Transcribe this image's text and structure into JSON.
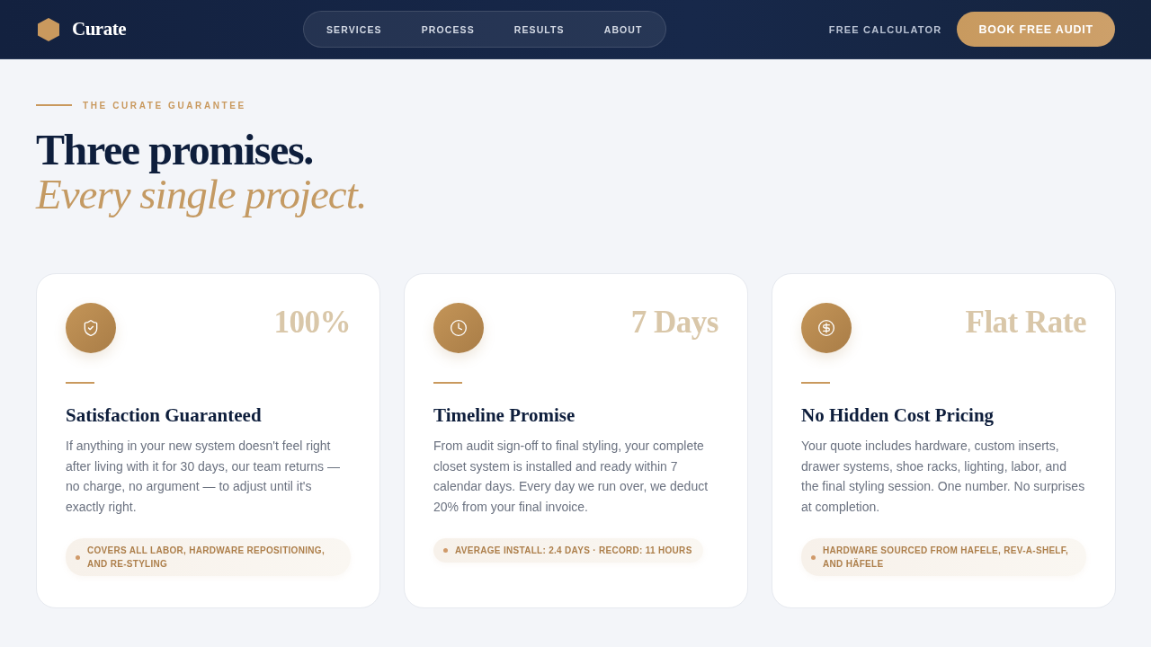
{
  "header": {
    "brand": "Curate",
    "nav": [
      "SERVICES",
      "PROCESS",
      "RESULTS",
      "ABOUT"
    ],
    "secondary_link": "FREE CALCULATOR",
    "cta": "BOOK FREE AUDIT"
  },
  "section": {
    "eyebrow": "THE CURATE GUARANTEE",
    "title": "Three promises.",
    "subtitle": "Every single project."
  },
  "cards": [
    {
      "kind": "shield",
      "stat": "100%",
      "title": "Satisfaction Guaranteed",
      "body": "If anything in your new system doesn't feel right after living with it for 30 days, our team returns — no charge, no argument — to adjust until it's exactly right.",
      "note": "COVERS ALL LABOR, HARDWARE REPOSITIONING, AND RE-STYLING"
    },
    {
      "kind": "clock",
      "stat": "7 Days",
      "title": "Timeline Promise",
      "body": "From audit sign-off to final styling, your complete closet system is installed and ready within 7 calendar days. Every day we run over, we deduct 20% from your final invoice.",
      "note": "AVERAGE INSTALL: 2.4 DAYS · RECORD: 11 HOURS"
    },
    {
      "kind": "dollar",
      "stat": "Flat Rate",
      "title": "No Hidden Cost Pricing",
      "body": "Your quote includes hardware, custom inserts, drawer systems, shoe racks, lighting, labor, and the final styling session. One number. No surprises at completion.",
      "note": "HARDWARE SOURCED FROM HAFELE, REV-A-SHELF, AND HÄFELE"
    }
  ]
}
